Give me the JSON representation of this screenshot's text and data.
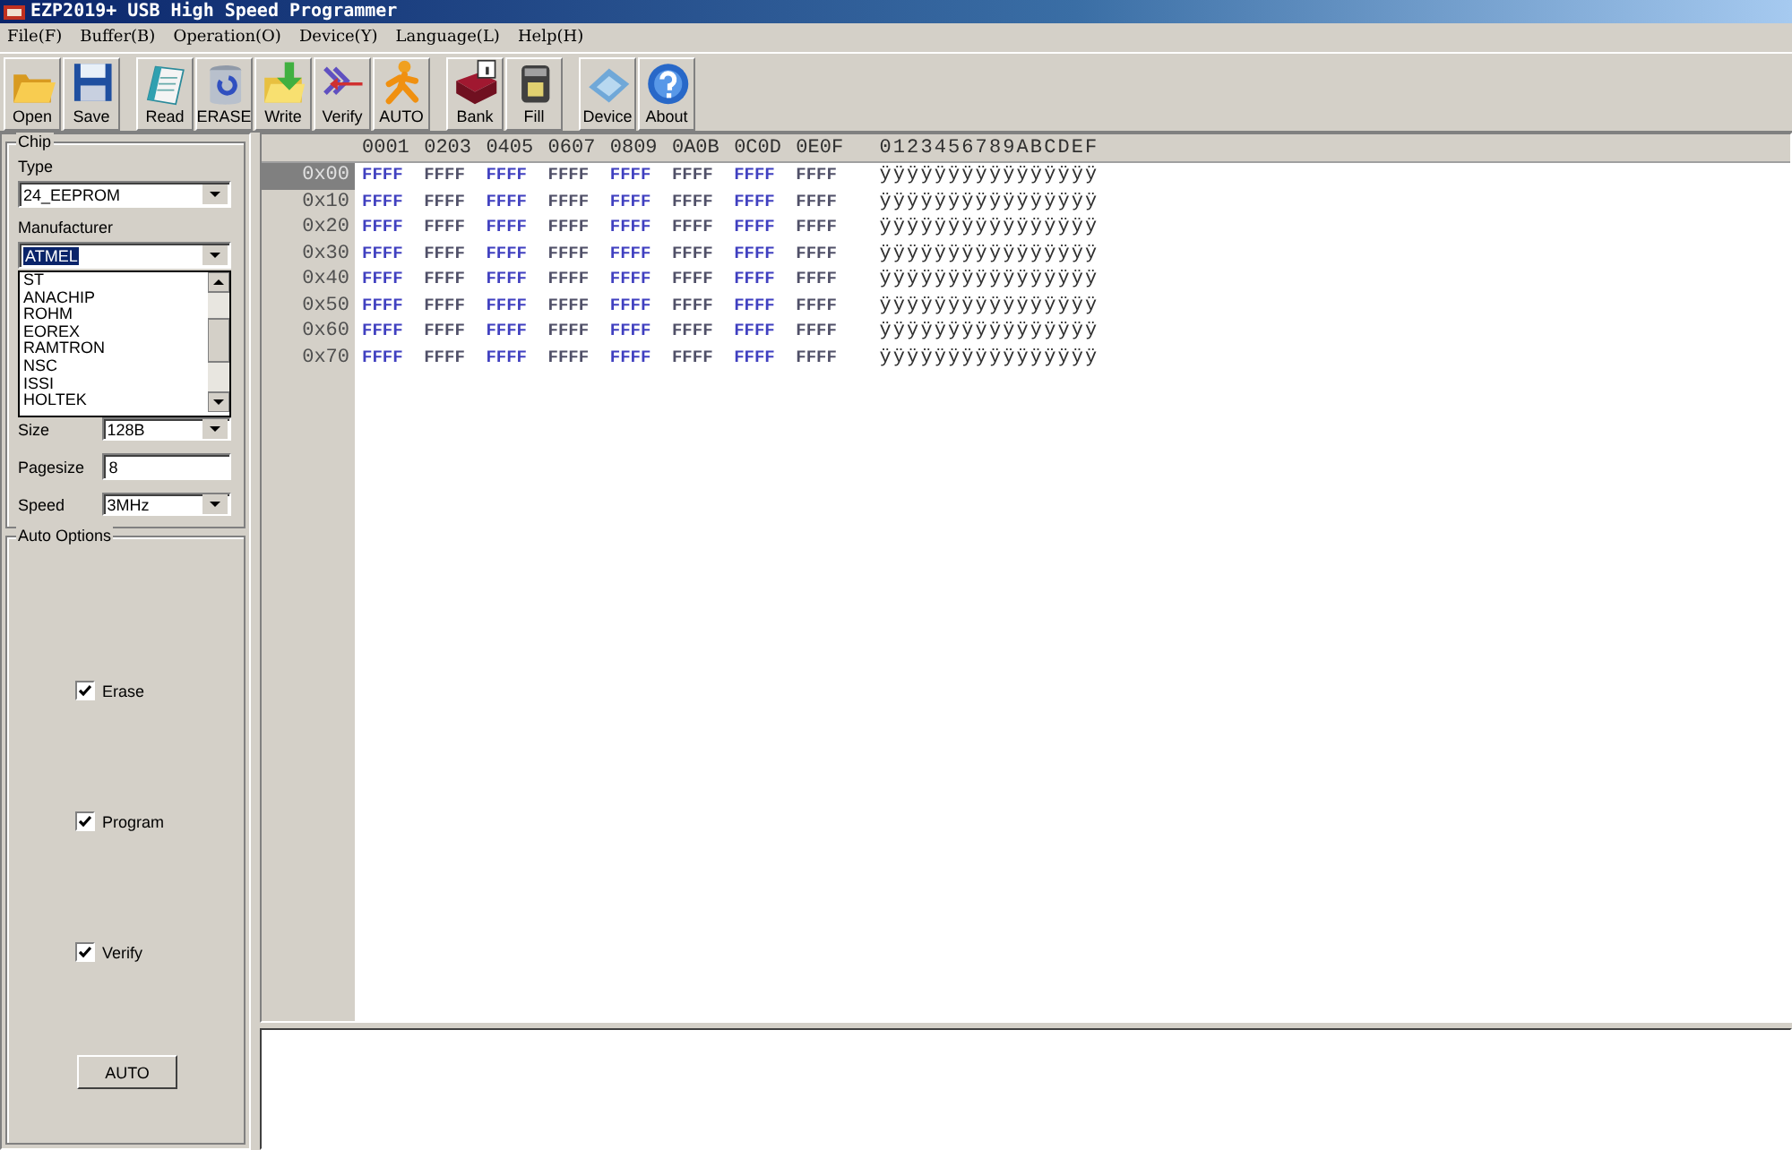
{
  "window": {
    "title": "EZP2019+ USB High Speed Programmer"
  },
  "menu": [
    "File(F)",
    "Buffer(B)",
    "Operation(O)",
    "Device(Y)",
    "Language(L)",
    "Help(H)"
  ],
  "toolbar": [
    {
      "buttons": [
        {
          "label": "Open",
          "kind": "open"
        },
        {
          "label": "Save",
          "kind": "save"
        }
      ]
    },
    {
      "buttons": [
        {
          "label": "Read",
          "kind": "read"
        },
        {
          "label": "ERASE",
          "kind": "erase"
        },
        {
          "label": "Write",
          "kind": "write"
        },
        {
          "label": "Verify",
          "kind": "verify"
        },
        {
          "label": "AUTO",
          "kind": "auto"
        }
      ]
    },
    {
      "buttons": [
        {
          "label": "Bank",
          "kind": "bank"
        },
        {
          "label": "Fill",
          "kind": "fill"
        }
      ]
    },
    {
      "buttons": [
        {
          "label": "Device",
          "kind": "device"
        },
        {
          "label": "About",
          "kind": "about"
        }
      ]
    }
  ],
  "chip": {
    "title": "Chip",
    "type_label": "Type",
    "type_value": "24_EEPROM",
    "manufacturer_label": "Manufacturer",
    "manufacturer_value": "ATMEL",
    "manufacturer_options": [
      "ST",
      "ANACHIP",
      "ROHM",
      "EOREX",
      "RAMTRON",
      "NSC",
      "ISSI",
      "HOLTEK"
    ],
    "size_label": "Size",
    "size_value": "128B",
    "pagesize_label": "Pagesize",
    "pagesize_value": "8",
    "speed_label": "Speed",
    "speed_value": "3MHz"
  },
  "auto_options": {
    "title": "Auto Options",
    "options": [
      {
        "label": "Erase",
        "checked": true
      },
      {
        "label": "Program",
        "checked": true
      },
      {
        "label": "Verify",
        "checked": true
      }
    ],
    "button": "AUTO"
  },
  "hex": {
    "columns": [
      "0001",
      "0203",
      "0405",
      "0607",
      "0809",
      "0A0B",
      "0C0D",
      "0E0F"
    ],
    "ascii_header": "0123456789ABCDEF",
    "rows": [
      {
        "address": "0x00",
        "selected": true,
        "words": [
          "FFFF",
          "FFFF",
          "FFFF",
          "FFFF",
          "FFFF",
          "FFFF",
          "FFFF",
          "FFFF"
        ],
        "ascii": "ÿÿÿÿÿÿÿÿÿÿÿÿÿÿÿÿ"
      },
      {
        "address": "0x10",
        "selected": false,
        "words": [
          "FFFF",
          "FFFF",
          "FFFF",
          "FFFF",
          "FFFF",
          "FFFF",
          "FFFF",
          "FFFF"
        ],
        "ascii": "ÿÿÿÿÿÿÿÿÿÿÿÿÿÿÿÿ"
      },
      {
        "address": "0x20",
        "selected": false,
        "words": [
          "FFFF",
          "FFFF",
          "FFFF",
          "FFFF",
          "FFFF",
          "FFFF",
          "FFFF",
          "FFFF"
        ],
        "ascii": "ÿÿÿÿÿÿÿÿÿÿÿÿÿÿÿÿ"
      },
      {
        "address": "0x30",
        "selected": false,
        "words": [
          "FFFF",
          "FFFF",
          "FFFF",
          "FFFF",
          "FFFF",
          "FFFF",
          "FFFF",
          "FFFF"
        ],
        "ascii": "ÿÿÿÿÿÿÿÿÿÿÿÿÿÿÿÿ"
      },
      {
        "address": "0x40",
        "selected": false,
        "words": [
          "FFFF",
          "FFFF",
          "FFFF",
          "FFFF",
          "FFFF",
          "FFFF",
          "FFFF",
          "FFFF"
        ],
        "ascii": "ÿÿÿÿÿÿÿÿÿÿÿÿÿÿÿÿ"
      },
      {
        "address": "0x50",
        "selected": false,
        "words": [
          "FFFF",
          "FFFF",
          "FFFF",
          "FFFF",
          "FFFF",
          "FFFF",
          "FFFF",
          "FFFF"
        ],
        "ascii": "ÿÿÿÿÿÿÿÿÿÿÿÿÿÿÿÿ"
      },
      {
        "address": "0x60",
        "selected": false,
        "words": [
          "FFFF",
          "FFFF",
          "FFFF",
          "FFFF",
          "FFFF",
          "FFFF",
          "FFFF",
          "FFFF"
        ],
        "ascii": "ÿÿÿÿÿÿÿÿÿÿÿÿÿÿÿÿ"
      },
      {
        "address": "0x70",
        "selected": false,
        "words": [
          "FFFF",
          "FFFF",
          "FFFF",
          "FFFF",
          "FFFF",
          "FFFF",
          "FFFF",
          "FFFF"
        ],
        "ascii": "ÿÿÿÿÿÿÿÿÿÿÿÿÿÿÿÿ"
      }
    ]
  }
}
